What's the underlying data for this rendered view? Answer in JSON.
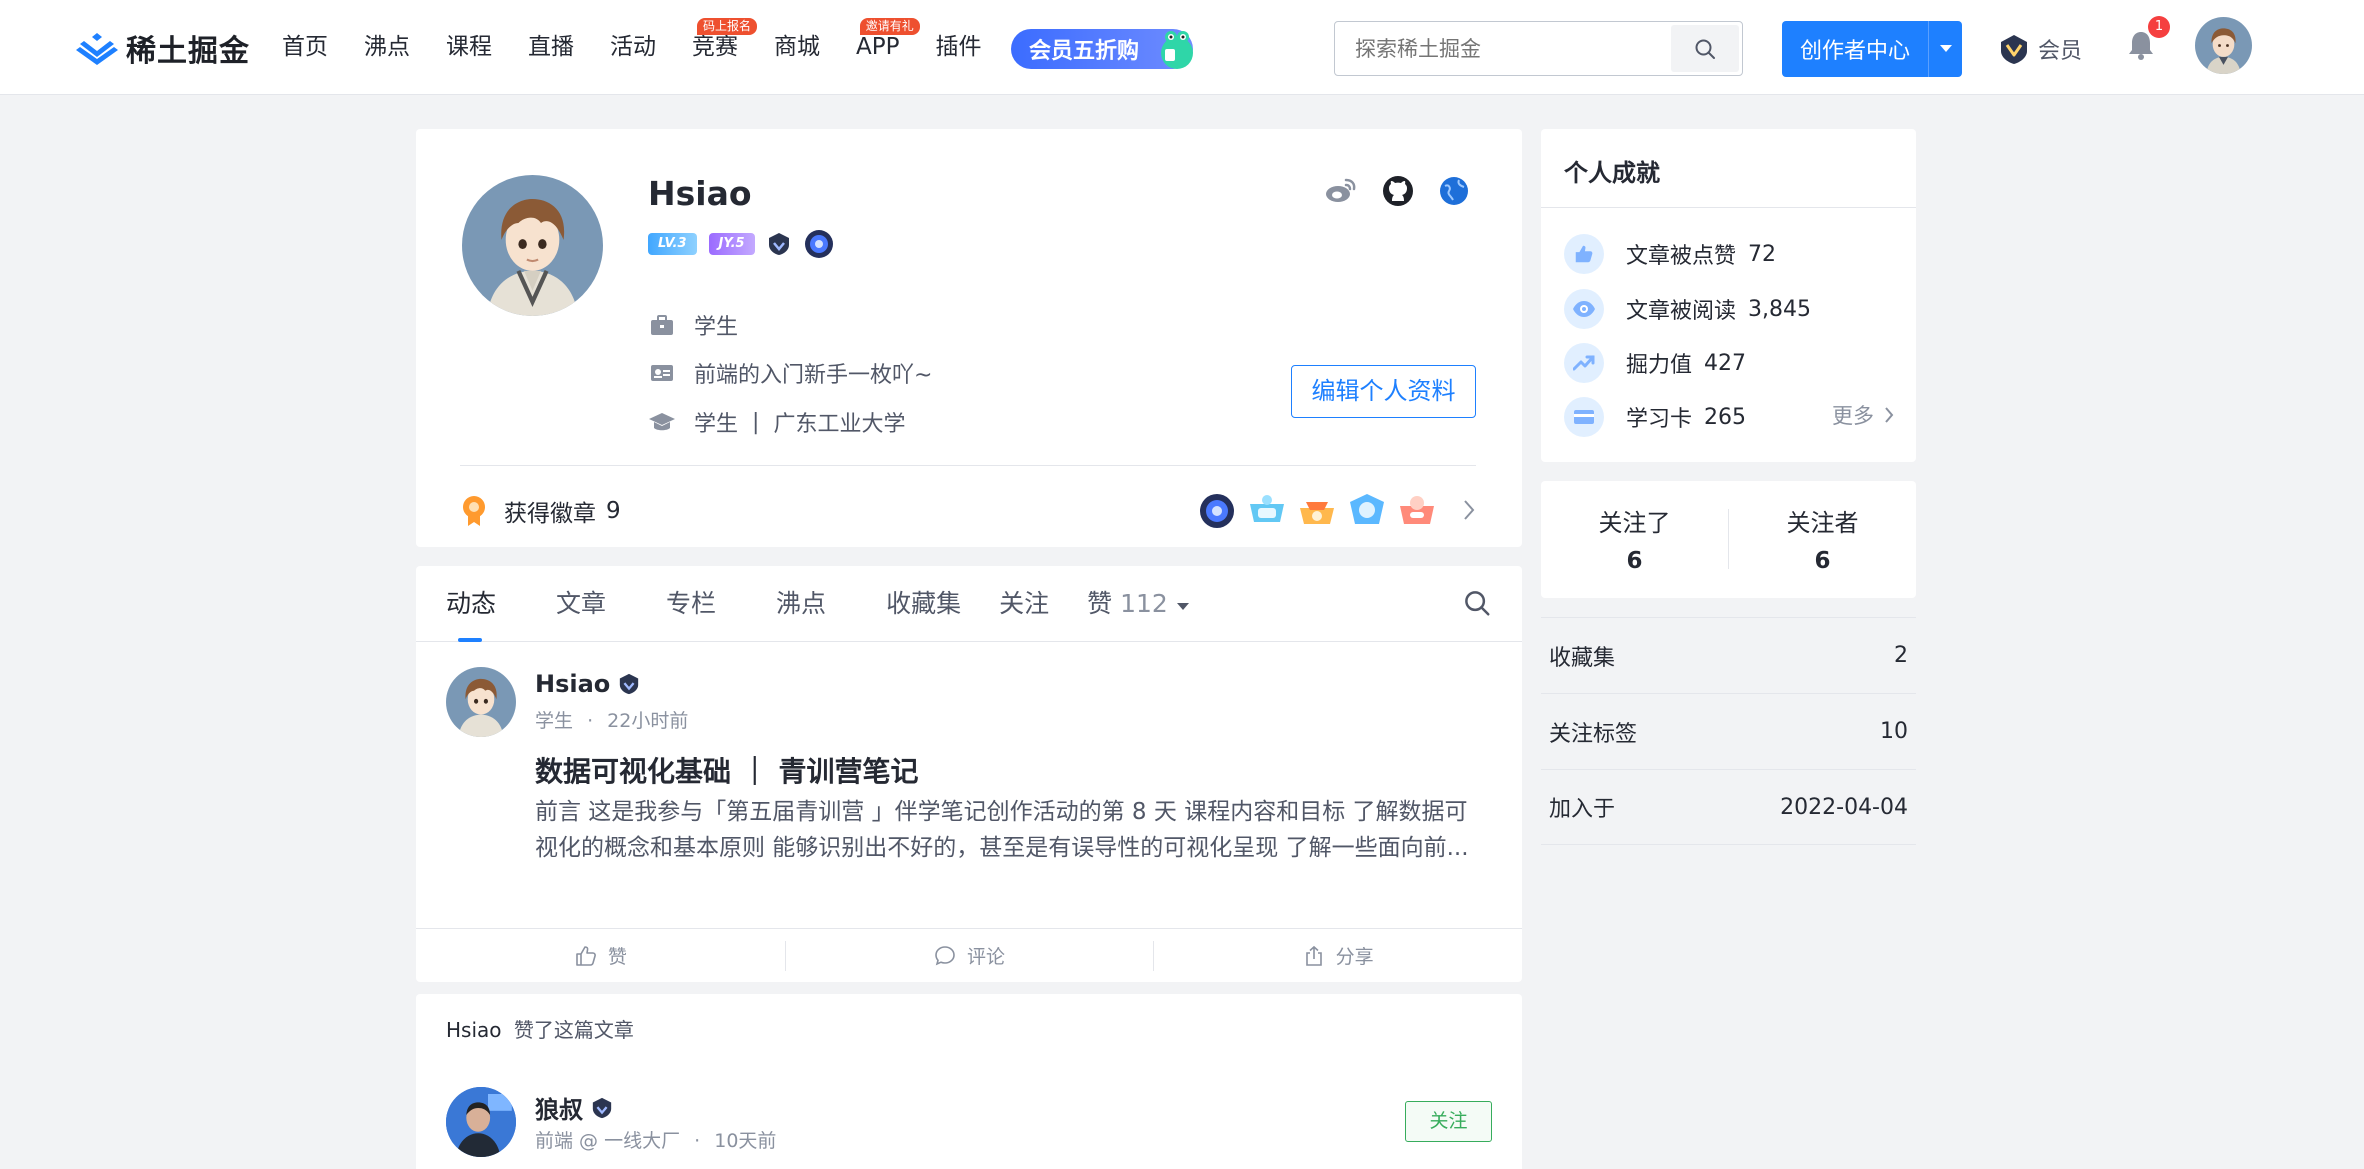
{
  "colors": {
    "brand": "#1e80ff",
    "follow_green": "#37ac5c",
    "badge_red": "#f53f3f"
  },
  "header": {
    "logo_text": "稀土掘金",
    "nav": [
      {
        "label": "首页",
        "tag": ""
      },
      {
        "label": "沸点",
        "tag": ""
      },
      {
        "label": "课程",
        "tag": ""
      },
      {
        "label": "直播",
        "tag": ""
      },
      {
        "label": "活动",
        "tag": ""
      },
      {
        "label": "竞赛",
        "tag": "码上报名"
      },
      {
        "label": "商城",
        "tag": ""
      },
      {
        "label": "APP",
        "tag": "邀请有礼"
      },
      {
        "label": "插件",
        "tag": ""
      }
    ],
    "vip_promo": "会员五折购",
    "search_placeholder": "探索稀土掘金",
    "creator_button": "创作者中心",
    "member_label": "会员",
    "notification_count": "1"
  },
  "profile": {
    "name": "Hsiao",
    "level_badge": "LV.3",
    "jy_badge": "JY.5",
    "occupation": "学生",
    "bio": "前端的入门新手一枚吖~",
    "school_role": "学生",
    "school_sep": "|",
    "school": "广东工业大学",
    "edit_button": "编辑个人资料",
    "badges_label": "获得徽章",
    "badges_count": "9",
    "social_icons": [
      "weibo-icon",
      "github-icon",
      "website-icon"
    ]
  },
  "feed": {
    "tabs": [
      {
        "label": "动态"
      },
      {
        "label": "文章"
      },
      {
        "label": "专栏"
      },
      {
        "label": "沸点"
      },
      {
        "label": "收藏集"
      },
      {
        "label": "关注"
      }
    ],
    "likes_tab": {
      "label": "赞",
      "count": "112"
    },
    "post": {
      "author": "Hsiao",
      "role": "学生",
      "time": "22小时前",
      "meta_sep": "·",
      "title": "数据可视化基础 ｜ 青训营笔记",
      "excerpt": "前言 这是我参与「第五届青训营 」伴学笔记创作活动的第 8 天 课程内容和目标 了解数据可视化的概念和基本原则 能够识别出不好的，甚至是有误导性的可视化呈现 了解一些面向前...",
      "actions": {
        "like": "赞",
        "comment": "评论",
        "share": "分享"
      }
    },
    "liked_post": {
      "who": "Hsiao",
      "action": "赞了这篇文章",
      "author": "狼叔",
      "role": "前端 @ 一线大厂",
      "meta_sep": "·",
      "time": "10天前",
      "follow_button": "关注"
    }
  },
  "sidebar": {
    "achievements_title": "个人成就",
    "achievements": [
      {
        "label": "文章被点赞",
        "value": "72",
        "icon": "thumbs-up-icon"
      },
      {
        "label": "文章被阅读",
        "value": "3,845",
        "icon": "eye-icon"
      },
      {
        "label": "掘力值",
        "value": "427",
        "icon": "trend-up-icon"
      },
      {
        "label": "学习卡",
        "value": "265",
        "icon": "card-icon"
      }
    ],
    "more": "更多",
    "following_label": "关注了",
    "following_count": "6",
    "followers_label": "关注者",
    "followers_count": "6",
    "stats": [
      {
        "label": "收藏集",
        "value": "2"
      },
      {
        "label": "关注标签",
        "value": "10"
      },
      {
        "label": "加入于",
        "value": "2022-04-04"
      }
    ]
  }
}
